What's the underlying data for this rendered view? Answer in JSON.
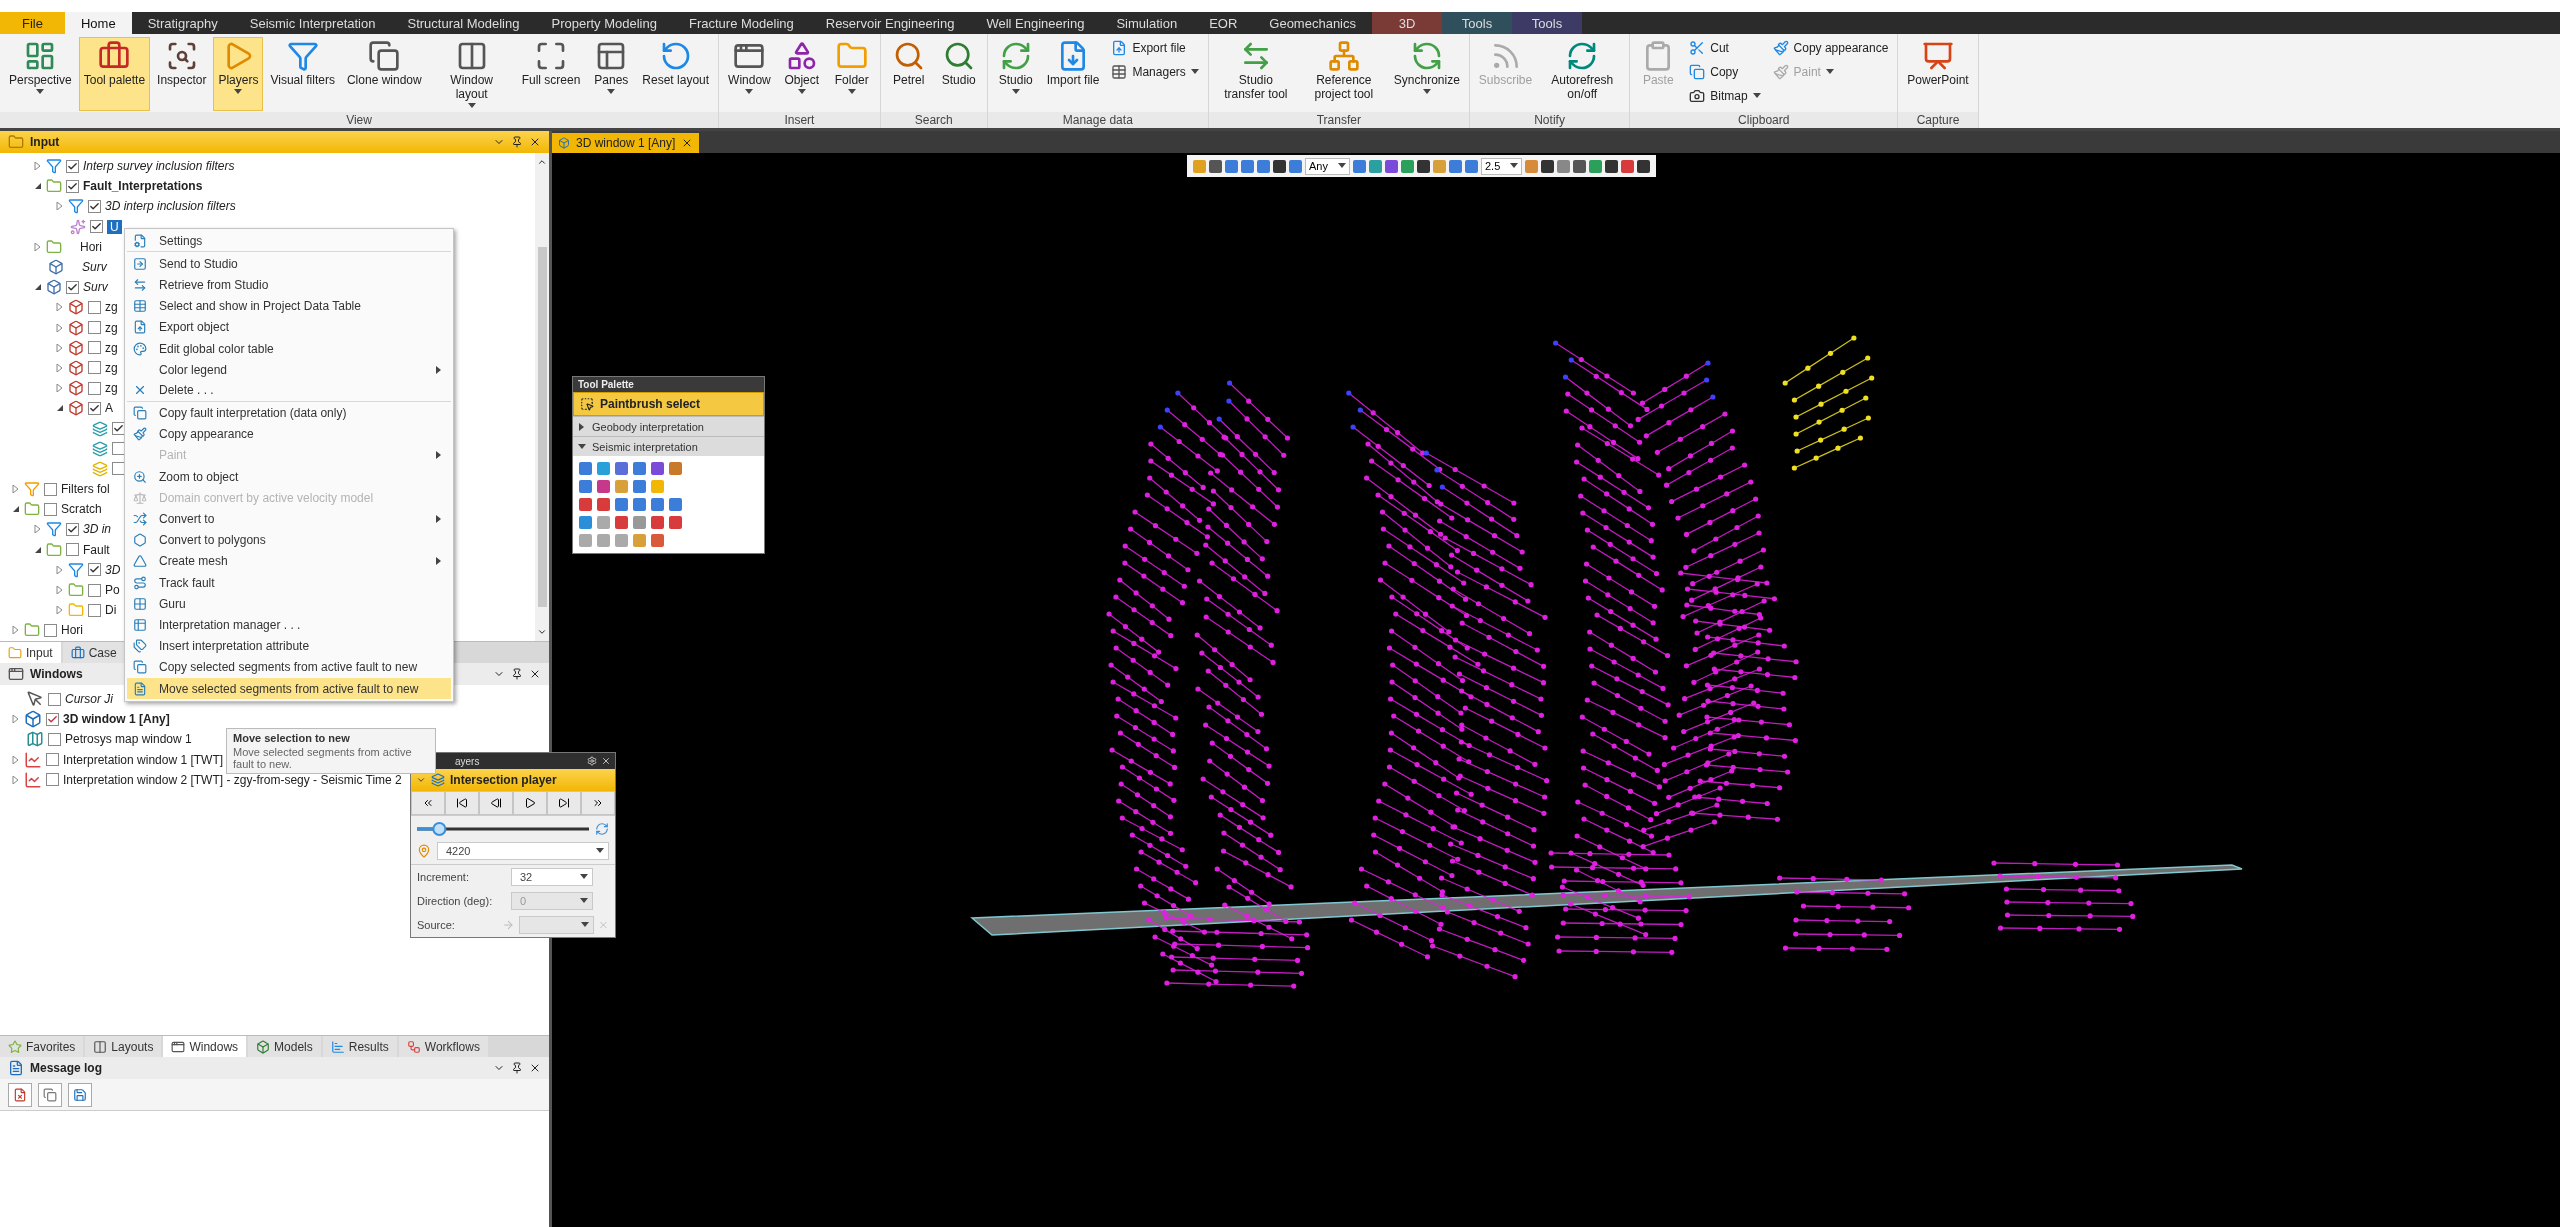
{
  "ribbon": {
    "tabs": [
      {
        "label": "File",
        "kind": "file",
        "selected": false
      },
      {
        "label": "Home",
        "kind": "normal",
        "selected": true
      },
      {
        "label": "Stratigraphy",
        "kind": "normal",
        "selected": false
      },
      {
        "label": "Seismic Interpretation",
        "kind": "normal",
        "selected": false
      },
      {
        "label": "Structural Modeling",
        "kind": "normal",
        "selected": false
      },
      {
        "label": "Property Modeling",
        "kind": "normal",
        "selected": false
      },
      {
        "label": "Fracture Modeling",
        "kind": "normal",
        "selected": false
      },
      {
        "label": "Reservoir Engineering",
        "kind": "normal",
        "selected": false
      },
      {
        "label": "Well Engineering",
        "kind": "normal",
        "selected": false
      },
      {
        "label": "Simulation",
        "kind": "normal",
        "selected": false
      },
      {
        "label": "EOR",
        "kind": "normal",
        "selected": false
      },
      {
        "label": "Geomechanics",
        "kind": "normal",
        "selected": false
      },
      {
        "label": "3D",
        "kind": "context",
        "color": "#7a3a36",
        "selected": false
      },
      {
        "label": "Tools",
        "kind": "context",
        "color": "#2f4f5c",
        "selected": false
      },
      {
        "label": "Tools",
        "kind": "context",
        "color": "#3d3a66",
        "selected": false
      }
    ],
    "groups": [
      {
        "label": "View",
        "buttons": [
          {
            "label": "Perspective",
            "kind": "large",
            "dropdown": true,
            "selected": false,
            "disabled": false
          },
          {
            "label": "Tool palette",
            "kind": "large",
            "dropdown": false,
            "selected": true,
            "disabled": false
          },
          {
            "label": "Inspector",
            "kind": "large",
            "dropdown": false,
            "selected": false,
            "disabled": false
          },
          {
            "label": "Players",
            "kind": "large",
            "dropdown": true,
            "selected": true,
            "disabled": false
          },
          {
            "label": "Visual filters",
            "kind": "large",
            "dropdown": false,
            "selected": false,
            "disabled": false
          },
          {
            "label": "Clone window",
            "kind": "large",
            "dropdown": false,
            "selected": false,
            "disabled": false
          },
          {
            "label": "Window layout",
            "kind": "large",
            "dropdown": true,
            "selected": false,
            "disabled": false
          },
          {
            "label": "Full screen",
            "kind": "large",
            "dropdown": false,
            "selected": false,
            "disabled": false
          },
          {
            "label": "Panes",
            "kind": "large",
            "dropdown": true,
            "selected": false,
            "disabled": false
          },
          {
            "label": "Reset layout",
            "kind": "large",
            "dropdown": false,
            "selected": false,
            "disabled": false
          }
        ]
      },
      {
        "label": "Insert",
        "buttons": [
          {
            "label": "Window",
            "kind": "large",
            "dropdown": true,
            "selected": false,
            "disabled": false
          },
          {
            "label": "Object",
            "kind": "large",
            "dropdown": true,
            "selected": false,
            "disabled": false
          },
          {
            "label": "Folder",
            "kind": "large",
            "dropdown": true,
            "selected": false,
            "disabled": false
          }
        ]
      },
      {
        "label": "Search",
        "buttons": [
          {
            "label": "Petrel",
            "kind": "large",
            "dropdown": false,
            "selected": false,
            "disabled": false
          },
          {
            "label": "Studio",
            "kind": "large",
            "dropdown": false,
            "selected": false,
            "disabled": false
          }
        ]
      },
      {
        "label": "Manage data",
        "buttons": [
          {
            "label": "Studio",
            "kind": "large",
            "dropdown": true,
            "selected": false,
            "disabled": false
          },
          {
            "label": "Import file",
            "kind": "large",
            "dropdown": false,
            "selected": false,
            "disabled": false
          },
          {
            "label": "Export file",
            "kind": "small",
            "dropdown": false,
            "selected": false,
            "disabled": false
          },
          {
            "label": "Managers",
            "kind": "small",
            "dropdown": true,
            "selected": false,
            "disabled": false
          }
        ]
      },
      {
        "label": "Transfer",
        "buttons": [
          {
            "label": "Studio transfer tool",
            "kind": "large",
            "dropdown": false,
            "selected": false,
            "disabled": false
          },
          {
            "label": "Reference project tool",
            "kind": "large",
            "dropdown": false,
            "selected": false,
            "disabled": false
          },
          {
            "label": "Synchronize",
            "kind": "large",
            "dropdown": true,
            "selected": false,
            "disabled": false
          }
        ]
      },
      {
        "label": "Notify",
        "buttons": [
          {
            "label": "Subscribe",
            "kind": "large",
            "dropdown": false,
            "selected": false,
            "disabled": true
          },
          {
            "label": "Autorefresh on/off",
            "kind": "large",
            "dropdown": false,
            "selected": false,
            "disabled": false
          }
        ]
      },
      {
        "label": "Clipboard",
        "buttons": [
          {
            "label": "Paste",
            "kind": "large",
            "dropdown": false,
            "selected": false,
            "disabled": true
          },
          {
            "label": "Cut",
            "kind": "small",
            "dropdown": false,
            "selected": false,
            "disabled": false
          },
          {
            "label": "Copy",
            "kind": "small",
            "dropdown": false,
            "selected": false,
            "disabled": false
          },
          {
            "label": "Bitmap",
            "kind": "small",
            "dropdown": true,
            "selected": false,
            "disabled": false
          },
          {
            "label": "Copy appearance",
            "kind": "small",
            "dropdown": false,
            "selected": false,
            "disabled": false
          },
          {
            "label": "Paint",
            "kind": "small",
            "dropdown": true,
            "selected": false,
            "disabled": true
          }
        ]
      },
      {
        "label": "Capture",
        "buttons": [
          {
            "label": "PowerPoint",
            "kind": "large",
            "dropdown": false,
            "selected": false,
            "disabled": false
          }
        ]
      }
    ]
  },
  "input_panel": {
    "title": "Input",
    "tree": [
      {
        "label": "Interp survey inclusion filters",
        "kind": "filter",
        "checked": true,
        "expanded": false,
        "selected": false
      },
      {
        "label": "Fault_Interpretations",
        "kind": "activefolder",
        "checked": true,
        "expanded": true,
        "selected": false,
        "children": [
          {
            "label": "3D interp inclusion filters",
            "kind": "filter",
            "checked": true,
            "expanded": false,
            "selected": false
          },
          {
            "label": "U",
            "kind": "fault",
            "checked": true,
            "selected": true
          }
        ]
      },
      {
        "label": "Hori",
        "kind": "folder",
        "expanded": false,
        "selected": false
      },
      {
        "label": "Surv",
        "kind": "survey",
        "selected": false
      },
      {
        "label": "Surv",
        "kind": "survey",
        "checked": true,
        "expanded": true,
        "selected": false,
        "children": [
          {
            "label": "zg",
            "kind": "cube",
            "checked": false,
            "expanded": false,
            "selected": false
          },
          {
            "label": "zg",
            "kind": "cube",
            "checked": false,
            "expanded": false,
            "selected": false
          },
          {
            "label": "zg",
            "kind": "cube",
            "checked": false,
            "expanded": false,
            "selected": false
          },
          {
            "label": "zg",
            "kind": "cube",
            "checked": false,
            "expanded": false,
            "selected": false
          },
          {
            "label": "zg",
            "kind": "cube",
            "checked": false,
            "expanded": false,
            "selected": false
          },
          {
            "label": "A",
            "kind": "cube",
            "checked": true,
            "expanded": true,
            "selected": false,
            "children": [
              {
                "kind": "slice",
                "checked": true
              },
              {
                "kind": "slice",
                "checked": false
              },
              {
                "kind": "slicegold",
                "checked": false
              }
            ]
          }
        ]
      }
    ]
  },
  "input_root": [
    {
      "label": "Filters fol",
      "kind": "filterfolder",
      "checked": false,
      "expanded": false,
      "selected": false
    },
    {
      "label": "Scratch",
      "kind": "folder",
      "checked": false,
      "expanded": true,
      "selected": false,
      "children": [
        {
          "label": "3D in",
          "kind": "filter",
          "checked": true,
          "expanded": false,
          "selected": false
        },
        {
          "label": "Fault",
          "kind": "folder",
          "checked": false,
          "expanded": true,
          "selected": false,
          "children": [
            {
              "label": "3D",
              "kind": "filter",
              "checked": true,
              "expanded": false,
              "selected": false
            },
            {
              "label": "Po",
              "kind": "folder",
              "checked": false,
              "expanded": false,
              "selected": false
            },
            {
              "label": "Di",
              "kind": "foldergold",
              "checked": false,
              "expanded": false,
              "selected": false
            }
          ]
        }
      ]
    },
    {
      "label": "Hori",
      "kind": "folder",
      "checked": false,
      "expanded": false,
      "selected": false
    }
  ],
  "panel_tabs": [
    {
      "label": "Input",
      "selected": true
    },
    {
      "label": "Case",
      "selected": false
    }
  ],
  "windows_panel": {
    "title": "Windows",
    "tree": [
      {
        "label": "Cursor Ji",
        "kind": "cursor",
        "checked": false,
        "active": false
      },
      {
        "label": "3D window 1 [Any]",
        "kind": "view",
        "checked": true,
        "active": true,
        "expanded": false
      },
      {
        "label": "Petrosys map window 1",
        "kind": "map",
        "checked": false,
        "active": false
      },
      {
        "label": "Interpretation window 1 [TWT]",
        "kind": "interp",
        "checked": false,
        "active": false,
        "expanded": false
      },
      {
        "label": "Interpretation window 2 [TWT] - zgy-from-segy - Seismic Time 2",
        "kind": "interp",
        "checked": false,
        "active": false,
        "expanded": false
      }
    ]
  },
  "bottom_tabs": [
    {
      "label": "Favorites",
      "selected": false
    },
    {
      "label": "Layouts",
      "selected": false
    },
    {
      "label": "Windows",
      "selected": true
    },
    {
      "label": "Models",
      "selected": false
    },
    {
      "label": "Results",
      "selected": false
    },
    {
      "label": "Workflows",
      "selected": false
    }
  ],
  "message_log": {
    "title": "Message log"
  },
  "document_tab": {
    "label": "3D window 1 [Any]"
  },
  "view_toolbar": {
    "mode": "Any",
    "scale": "2.5"
  },
  "tool_palette": {
    "title": "Tool Palette",
    "active_tool": "Paintbrush select",
    "sections": [
      {
        "label": "Geobody interpretation",
        "expanded": false
      },
      {
        "label": "Seismic interpretation",
        "expanded": true
      }
    ]
  },
  "context_menu": {
    "items": [
      {
        "label": "Settings",
        "disabled": false,
        "submenu": false,
        "highlighted": false,
        "separator_after": true
      },
      {
        "label": "Send to Studio",
        "disabled": false,
        "submenu": false,
        "highlighted": false,
        "separator_after": false
      },
      {
        "label": "Retrieve from Studio",
        "disabled": false,
        "submenu": false,
        "highlighted": false,
        "separator_after": false
      },
      {
        "label": "Select and show in Project Data Table",
        "disabled": false,
        "submenu": false,
        "highlighted": false,
        "separator_after": false
      },
      {
        "label": "Export object",
        "disabled": false,
        "submenu": false,
        "highlighted": false,
        "separator_after": false
      },
      {
        "label": "Edit global color table",
        "disabled": false,
        "submenu": false,
        "highlighted": false,
        "separator_after": false
      },
      {
        "label": "Color legend",
        "disabled": false,
        "submenu": true,
        "highlighted": false,
        "separator_after": false
      },
      {
        "label": "Delete . . .",
        "disabled": false,
        "submenu": false,
        "highlighted": false,
        "separator_after": true
      },
      {
        "label": "Copy fault interpretation (data only)",
        "disabled": false,
        "submenu": false,
        "highlighted": false,
        "separator_after": false
      },
      {
        "label": "Copy appearance",
        "disabled": false,
        "submenu": false,
        "highlighted": false,
        "separator_after": false
      },
      {
        "label": "Paint",
        "disabled": true,
        "submenu": true,
        "highlighted": false,
        "separator_after": false
      },
      {
        "label": "Zoom to object",
        "disabled": false,
        "submenu": false,
        "highlighted": false,
        "separator_after": false
      },
      {
        "label": "Domain convert by active velocity model",
        "disabled": true,
        "submenu": false,
        "highlighted": false,
        "separator_after": false
      },
      {
        "label": "Convert to",
        "disabled": false,
        "submenu": true,
        "highlighted": false,
        "separator_after": false
      },
      {
        "label": "Convert to polygons",
        "disabled": false,
        "submenu": false,
        "highlighted": false,
        "separator_after": false
      },
      {
        "label": "Create mesh",
        "disabled": false,
        "submenu": true,
        "highlighted": false,
        "separator_after": false
      },
      {
        "label": "Track fault",
        "disabled": false,
        "submenu": false,
        "highlighted": false,
        "separator_after": false
      },
      {
        "label": "Guru",
        "disabled": false,
        "submenu": false,
        "highlighted": false,
        "separator_after": false
      },
      {
        "label": "Interpretation manager . . .",
        "disabled": false,
        "submenu": false,
        "highlighted": false,
        "separator_after": false
      },
      {
        "label": "Insert interpretation attribute",
        "disabled": false,
        "submenu": false,
        "highlighted": false,
        "separator_after": false
      },
      {
        "label": "Copy selected segments from active fault to new",
        "disabled": false,
        "submenu": false,
        "highlighted": false,
        "separator_after": false
      },
      {
        "label": "Move selected segments from active fault to new",
        "disabled": false,
        "submenu": false,
        "highlighted": true,
        "separator_after": false
      }
    ]
  },
  "tooltip": {
    "title": "Move selection to new",
    "text": "Move selected segments from active fault to new."
  },
  "players": {
    "title": "ayers",
    "player": "Intersection player",
    "level": 0.13,
    "value": "4220",
    "fields": [
      {
        "label": "Increment:",
        "kind": "select",
        "value": "32",
        "disabled": false
      },
      {
        "label": "Direction (deg):",
        "kind": "select",
        "value": "0",
        "disabled": true
      },
      {
        "label": "Source:",
        "kind": "source",
        "disabled": true
      }
    ]
  }
}
